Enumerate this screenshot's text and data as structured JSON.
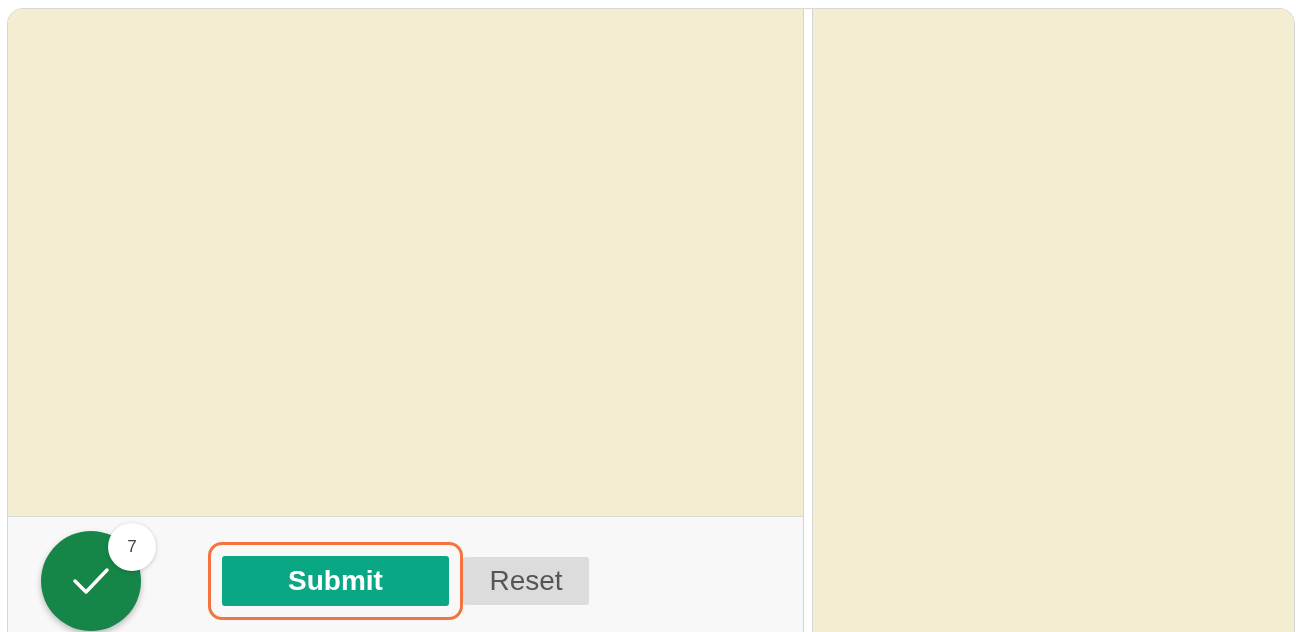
{
  "score_badge": {
    "count": "7"
  },
  "buttons": [
    {
      "label": "Submit",
      "kind": "primary",
      "highlighted": true
    },
    {
      "label": "Reset",
      "kind": "secondary",
      "highlighted": false
    }
  ]
}
